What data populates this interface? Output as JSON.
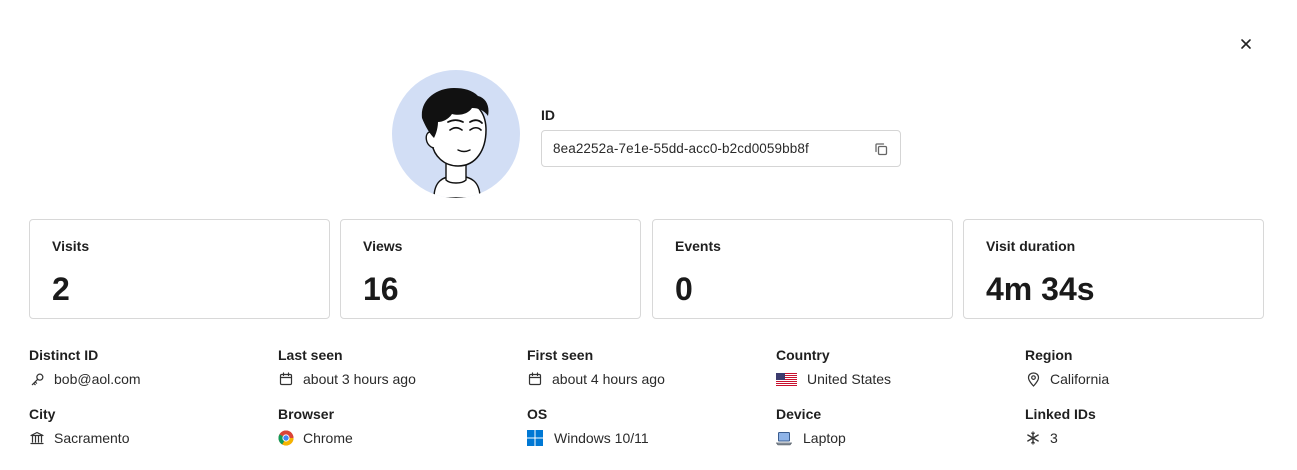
{
  "profile": {
    "id_label": "ID",
    "id_value": "8ea2252a-7e1e-55dd-acc0-b2cd0059bb8f"
  },
  "stats": [
    {
      "label": "Visits",
      "value": "2"
    },
    {
      "label": "Views",
      "value": "16"
    },
    {
      "label": "Events",
      "value": "0"
    },
    {
      "label": "Visit duration",
      "value": "4m 34s"
    }
  ],
  "properties": [
    {
      "label": "Distinct ID",
      "value": "bob@aol.com",
      "icon": "key-icon"
    },
    {
      "label": "Last seen",
      "value": "about 3 hours ago",
      "icon": "calendar-icon"
    },
    {
      "label": "First seen",
      "value": "about 4 hours ago",
      "icon": "calendar-icon"
    },
    {
      "label": "Country",
      "value": "United States",
      "icon": "us-flag-icon"
    },
    {
      "label": "Region",
      "value": "California",
      "icon": "map-pin-icon"
    },
    {
      "label": "City",
      "value": "Sacramento",
      "icon": "landmark-icon"
    },
    {
      "label": "Browser",
      "value": "Chrome",
      "icon": "chrome-icon"
    },
    {
      "label": "OS",
      "value": "Windows 10/11",
      "icon": "windows-icon"
    },
    {
      "label": "Device",
      "value": "Laptop",
      "icon": "laptop-icon"
    },
    {
      "label": "Linked IDs",
      "value": "3",
      "icon": "snowflake-icon"
    }
  ],
  "colors": {
    "avatar_bg": "#d2def5",
    "border": "#d8d8d8",
    "text": "#1f1f1f"
  }
}
